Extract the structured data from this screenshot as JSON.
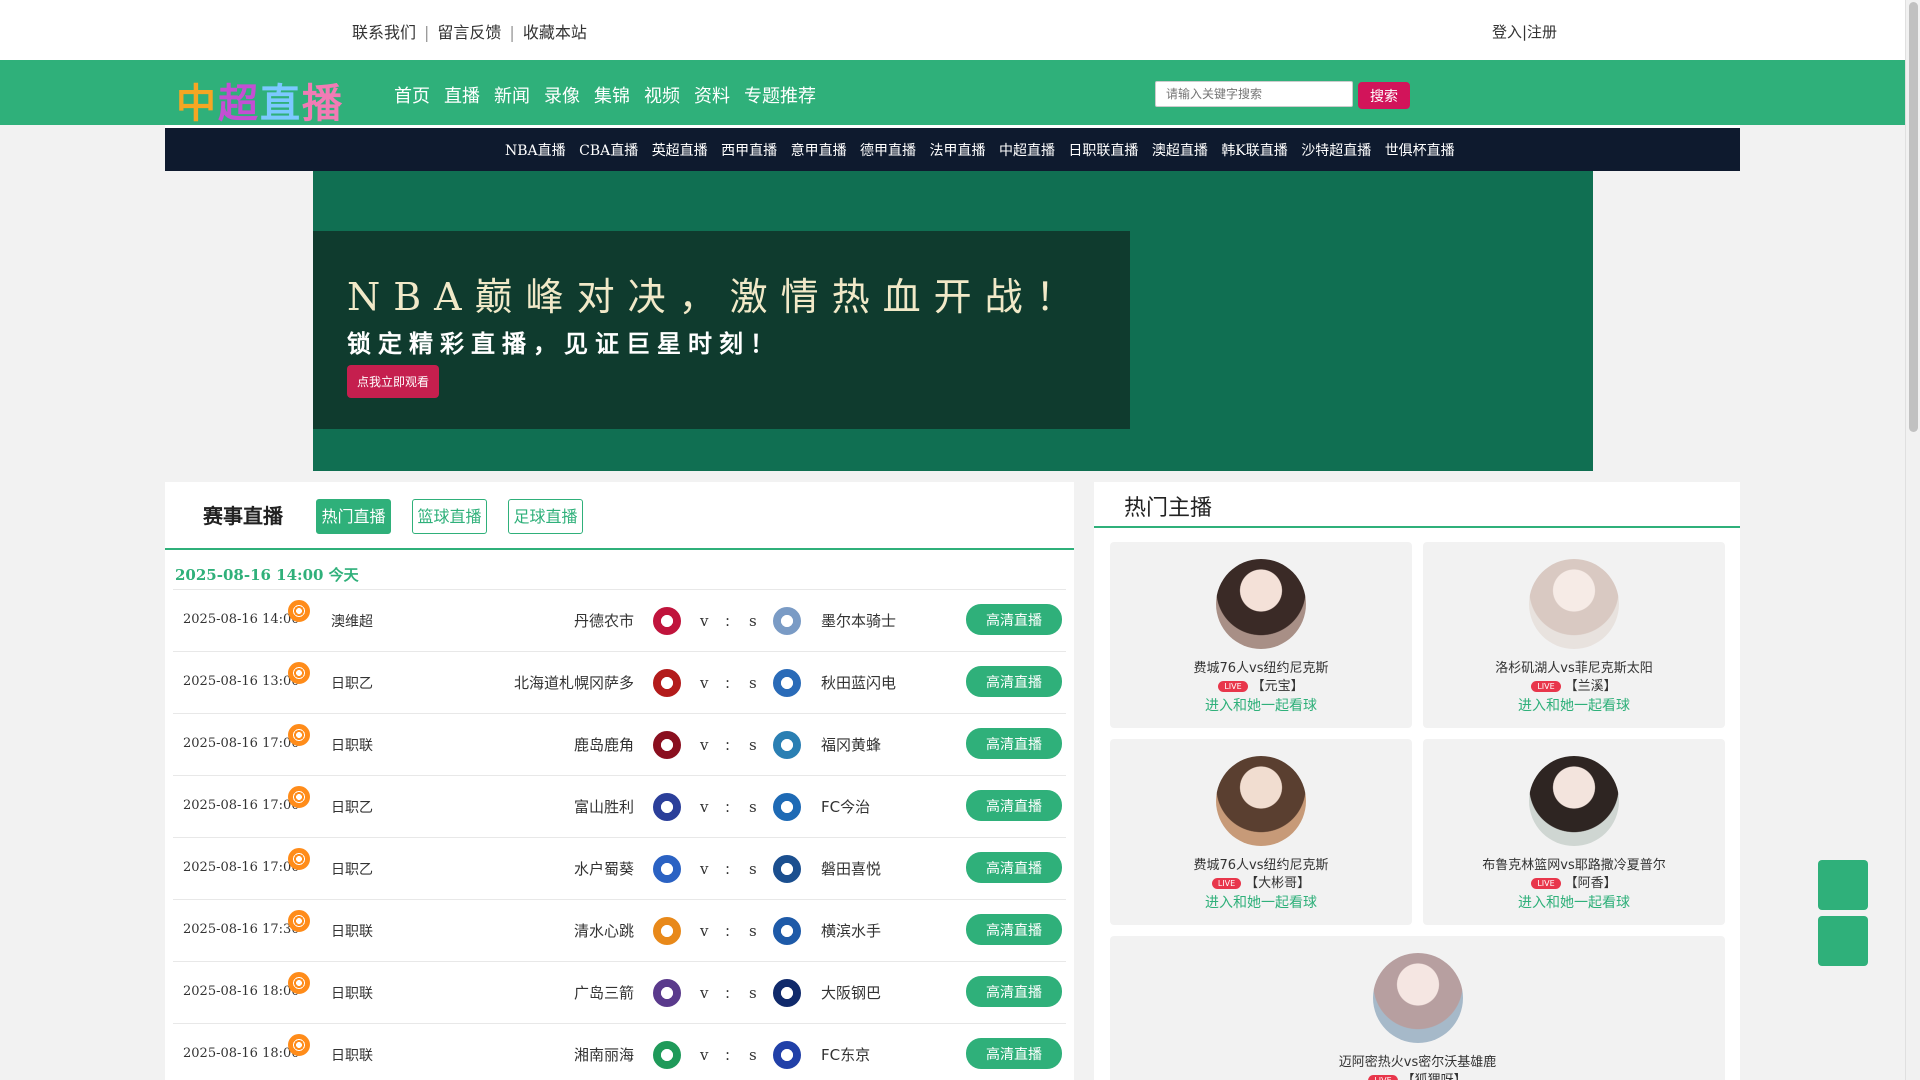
{
  "topbar": {
    "links": [
      "联系我们",
      "留言反馈",
      "收藏本站"
    ],
    "login": "登入|注册"
  },
  "logo": {
    "chars": [
      "中",
      "超",
      "直",
      "播"
    ]
  },
  "nav": [
    "首页",
    "直播",
    "新闻",
    "录像",
    "集锦",
    "视频",
    "资料",
    "专题推荐"
  ],
  "search": {
    "placeholder": "请输入关键字搜索",
    "button": "搜索"
  },
  "subnav": [
    "NBA直播",
    "CBA直播",
    "英超直播",
    "西甲直播",
    "意甲直播",
    "德甲直播",
    "法甲直播",
    "中超直播",
    "日职联直播",
    "澳超直播",
    "韩K联直播",
    "沙特超直播",
    "世俱杯直播"
  ],
  "banner": {
    "headline": "NBA巅峰对决，激情热血开战！",
    "sub": "锁定精彩直播，见证巨星时刻！",
    "cta": "点我立即观看"
  },
  "matches": {
    "title": "赛事直播",
    "tabs": [
      "热门直播",
      "篮球直播",
      "足球直播"
    ],
    "date_header": "2025-08-16 14:00  今天",
    "vs": "v",
    "colon": ":",
    "s": "s",
    "watch_label": "高清直播",
    "rows": [
      {
        "time": "2025-08-16 14:00",
        "league": "澳维超",
        "home": "丹德农市",
        "away": "墨尔本骑士"
      },
      {
        "time": "2025-08-16 13:00",
        "league": "日职乙",
        "home": "北海道札幌冈萨多",
        "away": "秋田蓝闪电"
      },
      {
        "time": "2025-08-16 17:00",
        "league": "日职联",
        "home": "鹿岛鹿角",
        "away": "福冈黄蜂"
      },
      {
        "time": "2025-08-16 17:00",
        "league": "日职乙",
        "home": "富山胜利",
        "away": "FC今治"
      },
      {
        "time": "2025-08-16 17:00",
        "league": "日职乙",
        "home": "水户蜀葵",
        "away": "磐田喜悦"
      },
      {
        "time": "2025-08-16 17:30",
        "league": "日职联",
        "home": "清水心跳",
        "away": "横滨水手"
      },
      {
        "time": "2025-08-16 18:00",
        "league": "日职联",
        "home": "广岛三箭",
        "away": "大阪钢巴"
      },
      {
        "time": "2025-08-16 18:00",
        "league": "日职联",
        "home": "湘南丽海",
        "away": "FC东京"
      }
    ]
  },
  "hosts": {
    "title": "热门主播",
    "live_badge": "LIVE",
    "enter_label": "进入和她一起看球",
    "cards": [
      {
        "match": "费城76人vs纽约尼克斯",
        "name": "【元宝】"
      },
      {
        "match": "洛杉矶湖人vs菲尼克斯太阳",
        "name": "【兰溪】"
      },
      {
        "match": "费城76人vs纽约尼克斯",
        "name": "【大彬哥】"
      },
      {
        "match": "布鲁克林篮网vs耶路撒冷夏普尔",
        "name": "【阿香】"
      },
      {
        "match": "迈阿密热火vs密尔沃基雄鹿",
        "name": "【狐狸呀】"
      }
    ]
  },
  "colors": {
    "brand_green": "#2fb07a",
    "dark_nav": "#0e1a2e",
    "accent_red": "#d2145a"
  }
}
